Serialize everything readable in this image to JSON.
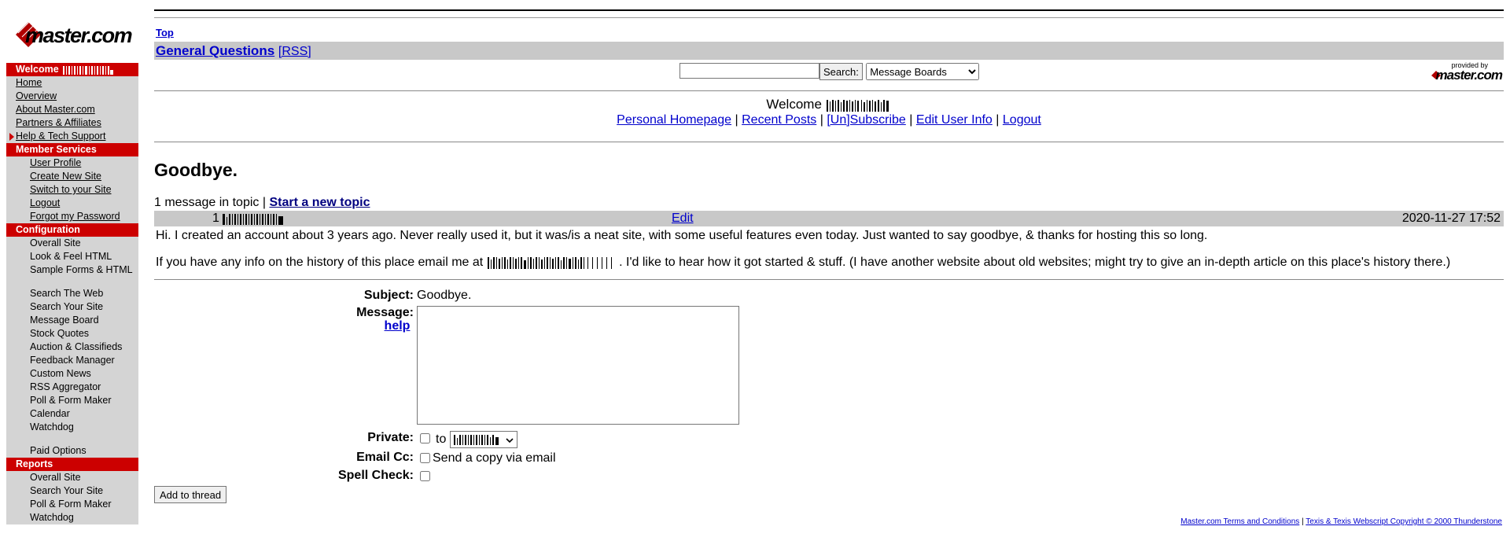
{
  "brand": {
    "logo_text": "master.com",
    "provided_by": "provided by",
    "provided_logo": "master.com",
    "accent_color": "#cc0000"
  },
  "sidebar": {
    "sections": [
      {
        "title": "Welcome",
        "items": [
          {
            "label": "Home",
            "link": true
          },
          {
            "label": "Overview",
            "link": true
          },
          {
            "label": "About Master.com",
            "link": true
          },
          {
            "label": "Partners & Affiliates",
            "link": true
          },
          {
            "label": "Help & Tech Support",
            "link": true,
            "active": true
          }
        ]
      },
      {
        "title": "Member Services",
        "items": [
          {
            "label": "User Profile",
            "link": true
          },
          {
            "label": "Create New Site",
            "link": true
          },
          {
            "label": "Switch to your Site",
            "link": true
          },
          {
            "label": "Logout",
            "link": true
          },
          {
            "label": "Forgot my Password",
            "link": true
          }
        ]
      },
      {
        "title": "Configuration",
        "items": [
          {
            "label": "Overall Site"
          },
          {
            "label": "Look & Feel HTML"
          },
          {
            "label": "Sample Forms & HTML"
          },
          {
            "label": "Search The Web"
          },
          {
            "label": "Search Your Site"
          },
          {
            "label": "Message Board"
          },
          {
            "label": "Stock Quotes"
          },
          {
            "label": "Auction & Classifieds"
          },
          {
            "label": "Feedback Manager"
          },
          {
            "label": "Custom News"
          },
          {
            "label": "RSS Aggregator"
          },
          {
            "label": "Poll & Form Maker"
          },
          {
            "label": "Calendar"
          },
          {
            "label": "Watchdog"
          },
          {
            "label": "Paid Options"
          }
        ]
      },
      {
        "title": "Reports",
        "items": [
          {
            "label": "Overall Site"
          },
          {
            "label": "Search Your Site"
          },
          {
            "label": "Poll & Form Maker"
          },
          {
            "label": "Watchdog"
          }
        ]
      }
    ]
  },
  "header": {
    "top_link": "Top",
    "board_title": "General Questions",
    "rss_label": "[RSS]",
    "search_button": "Search:",
    "search_scope": "Message Boards",
    "search_value": ""
  },
  "welcome": {
    "text": "Welcome",
    "links": [
      "Personal Homepage",
      "Recent Posts",
      "[Un]Subscribe",
      "Edit User Info",
      "Logout"
    ],
    "separator": "|"
  },
  "topic": {
    "title": "Goodbye.",
    "count_text": "1 message in topic |",
    "new_topic_link": "Start a new topic"
  },
  "message": {
    "number": "1",
    "edit_label": "Edit",
    "date": "2020-11-27 17:52",
    "line1": "Hi. I created an account about 3 years ago. Never really used it, but it was/is a neat site, with some useful features even today. Just wanted to say goodbye, & thanks for hosting this so long.",
    "line2_before": "If you have any info on the history of this place email me at",
    "line2_after": ". I'd like to hear how it got started & stuff. (I have another website about old websites; might try to give an in-depth article on this place's history there.)"
  },
  "reply_form": {
    "subject_label": "Subject:",
    "subject_value": "Goodbye.",
    "message_label": "Message:",
    "help_link": "help",
    "private_label": "Private:",
    "to_label": "to",
    "email_label": "Email Cc:",
    "email_text": "Send a copy via email",
    "spell_label": "Spell Check:",
    "submit_label": "Add to thread"
  },
  "footer": {
    "terms_link": "Master.com Terms and Conditions",
    "separator": "|",
    "copyright_link": "Texis & Texis Webscript Copyright © 2000 Thunderstone"
  }
}
